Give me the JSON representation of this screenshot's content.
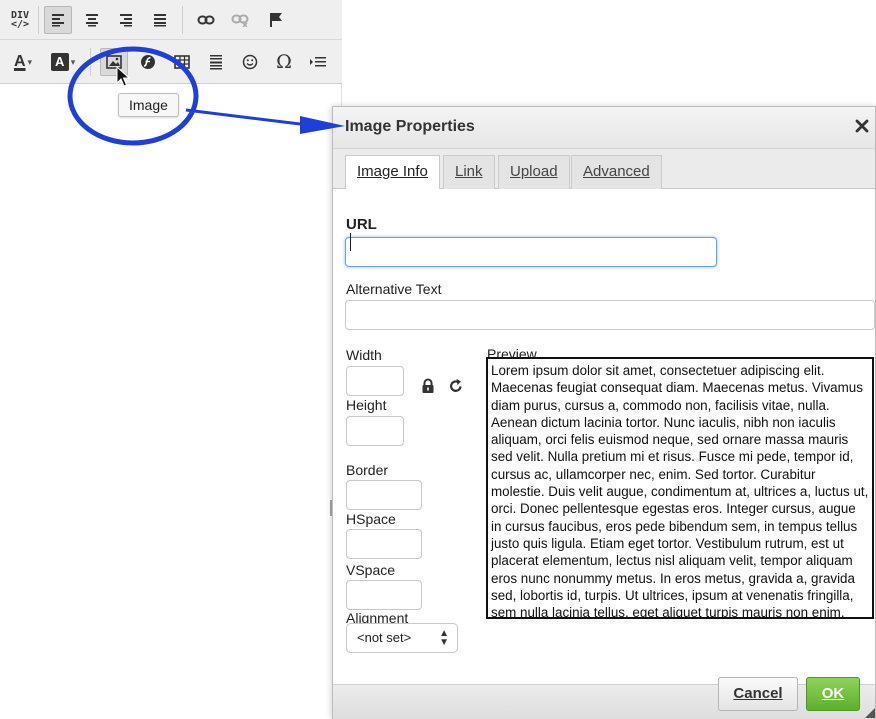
{
  "toolbar": {
    "div_label_top": "DIV",
    "div_label_bottom": "</>",
    "text_color_label": "A",
    "bg_color_label": "A",
    "tooltip": "Image"
  },
  "dialog": {
    "title": "Image Properties",
    "close_glyph": "✕",
    "tabs": [
      {
        "label": "Image Info",
        "selected": true
      },
      {
        "label": "Link",
        "selected": false
      },
      {
        "label": "Upload",
        "selected": false
      },
      {
        "label": "Advanced",
        "selected": false
      }
    ],
    "fields": {
      "url_label": "URL",
      "url_value": "",
      "alt_label": "Alternative Text",
      "alt_value": "",
      "width_label": "Width",
      "height_label": "Height",
      "border_label": "Border",
      "hspace_label": "HSpace",
      "vspace_label": "VSpace",
      "alignment_label": "Alignment",
      "alignment_value": "<not set>",
      "preview_label": "Preview"
    },
    "preview_text": "Lorem ipsum dolor sit amet, consectetuer adipiscing elit. Maecenas feugiat consequat diam. Maecenas metus. Vivamus diam purus, cursus a, commodo non, facilisis vitae, nulla. Aenean dictum lacinia tortor. Nunc iaculis, nibh non iaculis aliquam, orci felis euismod neque, sed ornare massa mauris sed velit. Nulla pretium mi et risus. Fusce mi pede, tempor id, cursus ac, ullamcorper nec, enim. Sed tortor. Curabitur molestie. Duis velit augue, condimentum at, ultrices a, luctus ut, orci. Donec pellentesque egestas eros. Integer cursus, augue in cursus faucibus, eros pede bibendum sem, in tempus tellus justo quis ligula. Etiam eget tortor. Vestibulum rutrum, est ut placerat elementum, lectus nisl aliquam velit, tempor aliquam eros nunc nonummy metus. In eros metus, gravida a, gravida sed, lobortis id, turpis. Ut ultrices, ipsum at venenatis fringilla, sem nulla lacinia tellus, eget aliquet turpis mauris non enim.",
    "buttons": {
      "cancel": "Cancel",
      "ok": "OK"
    }
  },
  "colors": {
    "annotation": "#1f3fd6",
    "ok_button": "#6cbd3a",
    "input_focus": "#6aa0e8"
  }
}
